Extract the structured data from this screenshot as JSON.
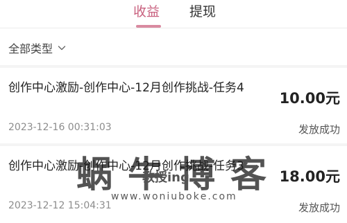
{
  "tabs": [
    {
      "label": "收益",
      "active": true
    },
    {
      "label": "提现",
      "active": false
    }
  ],
  "filter": {
    "label": "全部类型",
    "icon": "chevron-down-icon"
  },
  "records": [
    {
      "title": "创作中心激励-创作中心-12月创作挑战-任务4",
      "amount": "10.00元",
      "time": "2023-12-16 00:31:03",
      "status": "发放成功"
    },
    {
      "title": "创作中心激励-创作中心-12月创作挑战-任务3",
      "amount": "18.00元",
      "time": "2023-12-12 15:04:31",
      "status": "发放成功"
    }
  ],
  "watermark": {
    "name": "蜗牛博客",
    "sub": "教授ing",
    "url": "www.woniubokе.com"
  },
  "colors": {
    "accent": "#c8607e",
    "indicator": "#d98aa0",
    "secondary_text": "#8c8c8c"
  }
}
